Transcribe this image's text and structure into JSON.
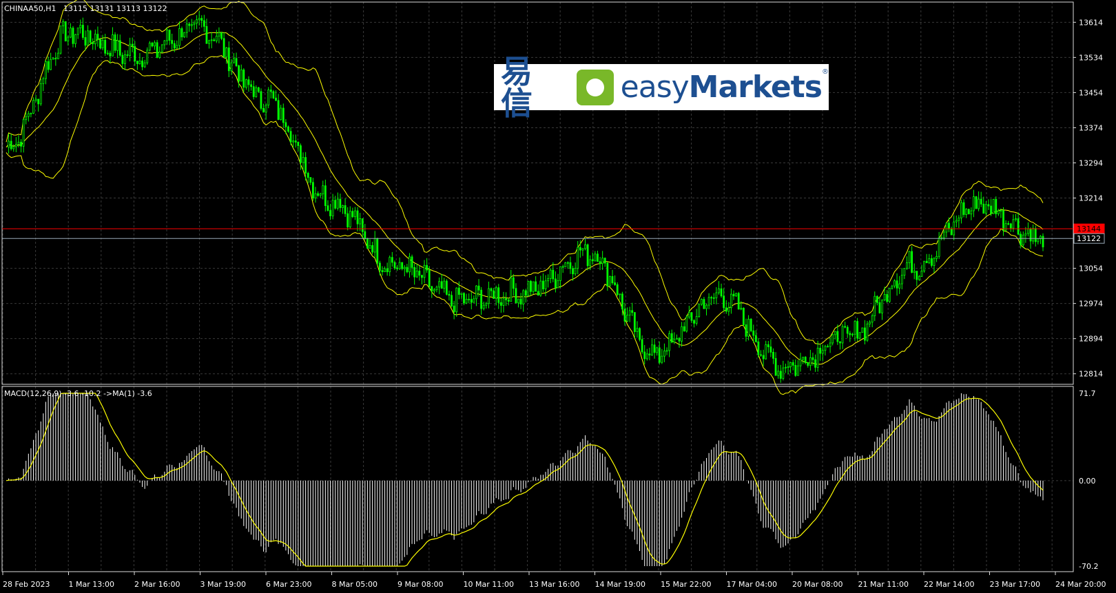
{
  "window": {
    "symbol_label": "CHINAA50,H1",
    "ohlc": "13115 13131 13113 13122"
  },
  "main_axis": {
    "ticks": [
      "13614",
      "13534",
      "13454",
      "13374",
      "13294",
      "13214",
      "13054",
      "12974",
      "12894",
      "12814"
    ],
    "price_markers": [
      {
        "label": "13144",
        "value": 13144,
        "color": "#ff0000"
      },
      {
        "label": "13122",
        "value": 13122,
        "color": "#9aaab8"
      }
    ]
  },
  "macd": {
    "label": "MACD(12,26,9) -3.6 -10.2  ->MA(1) -3.6",
    "ticks": [
      "71.7",
      "0.00",
      "-70.2"
    ]
  },
  "time_axis": {
    "labels": [
      "28 Feb 2023",
      "1 Mar 13:00",
      "2 Mar 16:00",
      "3 Mar 19:00",
      "6 Mar 23:00",
      "8 Mar 05:00",
      "9 Mar 08:00",
      "10 Mar 11:00",
      "13 Mar 16:00",
      "14 Mar 19:00",
      "15 Mar 22:00",
      "17 Mar 04:00",
      "20 Mar 08:00",
      "21 Mar 11:00",
      "22 Mar 14:00",
      "23 Mar 17:00",
      "24 Mar 20:00"
    ]
  },
  "logo": {
    "chinese": "易信",
    "word_light": "easy",
    "word_bold": "Markets",
    "registered": "®"
  },
  "colors": {
    "background": "#000000",
    "candles": "#00ff00",
    "bands": "#ffff00",
    "macd_histogram": "#ffffff",
    "signal": "#ffff00",
    "grid": "#3a3a3a",
    "brand_blue": "#1d4f91",
    "brand_green": "#79b829"
  },
  "chart_data": {
    "type": "line",
    "series": [
      {
        "name": "CHINAA50,H1",
        "x": [
          "28 Feb 2023",
          "1 Mar 13:00",
          "2 Mar 16:00",
          "3 Mar 19:00",
          "6 Mar 23:00",
          "8 Mar 05:00",
          "9 Mar 08:00",
          "10 Mar 11:00",
          "13 Mar 16:00",
          "14 Mar 19:00",
          "15 Mar 22:00",
          "17 Mar 04:00",
          "20 Mar 08:00",
          "21 Mar 11:00",
          "22 Mar 14:00",
          "23 Mar 17:00",
          "24 Mar 20:00"
        ],
        "y": [
          13330,
          13590,
          13540,
          13600,
          13440,
          13210,
          13060,
          12980,
          13000,
          13090,
          12860,
          12990,
          12830,
          12900,
          13060,
          13200,
          13122
        ]
      }
    ],
    "ylim": [
      12790,
      13660
    ],
    "macd_ylim": [
      -70.2,
      71.7
    ],
    "grid": true
  }
}
